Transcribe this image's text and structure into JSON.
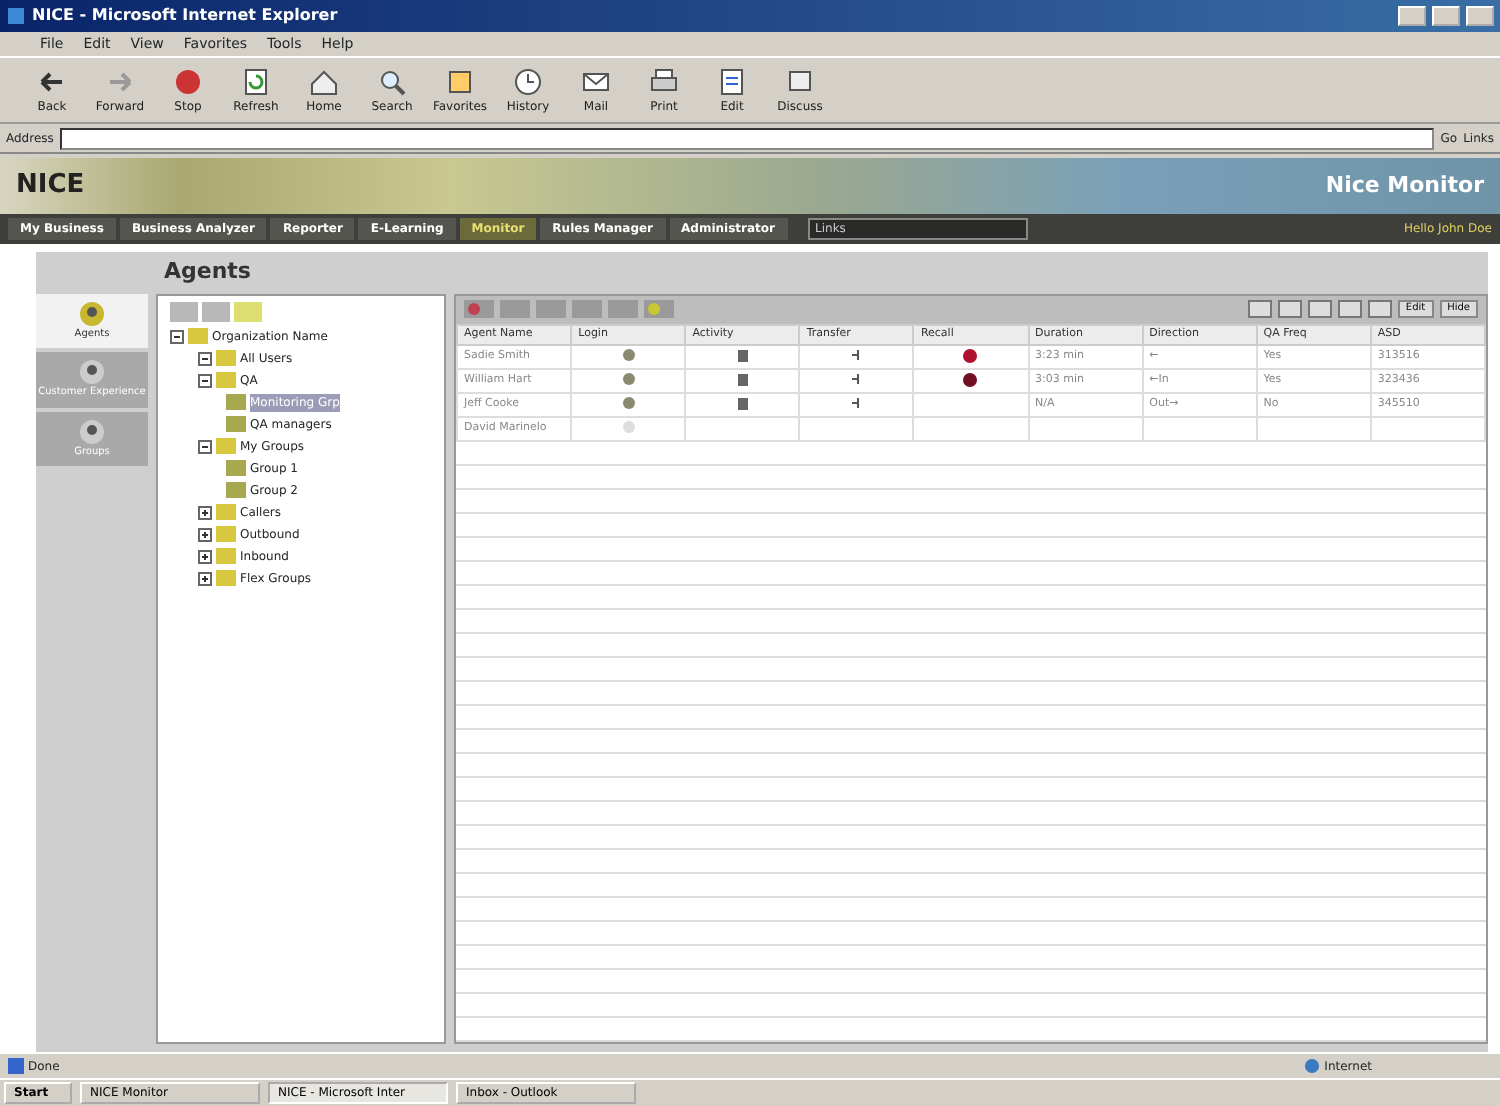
{
  "window": {
    "title": "NICE - Microsoft Internet Explorer"
  },
  "menu": [
    "File",
    "Edit",
    "View",
    "Favorites",
    "Tools",
    "Help"
  ],
  "toolbar": [
    {
      "label": "Back",
      "kind": "back"
    },
    {
      "label": "Forward",
      "kind": "forward"
    },
    {
      "label": "Stop",
      "kind": "stop"
    },
    {
      "label": "Refresh",
      "kind": "refresh"
    },
    {
      "label": "Home",
      "kind": "home"
    },
    {
      "label": "Search",
      "kind": "search"
    },
    {
      "label": "Favorites",
      "kind": "favorites"
    },
    {
      "label": "History",
      "kind": "history"
    },
    {
      "label": "Mail",
      "kind": "mail"
    },
    {
      "label": "Print",
      "kind": "print"
    },
    {
      "label": "Edit",
      "kind": "edit"
    },
    {
      "label": "Discuss",
      "kind": "discuss"
    }
  ],
  "address": {
    "label": "Address",
    "go": "Go",
    "links": "Links"
  },
  "banner": {
    "logo": "NICE",
    "product": "Nice Monitor"
  },
  "nav": {
    "tabs": [
      {
        "label": "My Business",
        "selected": false
      },
      {
        "label": "Business Analyzer",
        "selected": false
      },
      {
        "label": "Reporter",
        "selected": false
      },
      {
        "label": "E-Learning",
        "selected": false
      },
      {
        "label": "Monitor",
        "selected": true
      },
      {
        "label": "Rules Manager",
        "selected": false
      },
      {
        "label": "Administrator",
        "selected": false
      }
    ],
    "links": "Links",
    "greeting": "Hello John Doe"
  },
  "page_title": "Agents",
  "sidebar": [
    {
      "label": "Agents",
      "selected": true
    },
    {
      "label": "Customer Experience",
      "selected": false
    },
    {
      "label": "Groups",
      "selected": false
    }
  ],
  "tree": [
    {
      "label": "Organization Name",
      "expanded": true,
      "selected": false,
      "children": [
        {
          "label": "All Users",
          "expanded": true,
          "selected": false
        },
        {
          "label": "QA",
          "expanded": true,
          "selected": false,
          "children": [
            {
              "label": "Monitoring Grp",
              "selected": true
            },
            {
              "label": "QA managers",
              "selected": false
            }
          ]
        },
        {
          "label": "My Groups",
          "expanded": true,
          "selected": false,
          "children": [
            {
              "label": "Group 1",
              "selected": false
            },
            {
              "label": "Group 2",
              "selected": false
            }
          ]
        },
        {
          "label": "Callers",
          "expanded": false,
          "selected": false
        },
        {
          "label": "Outbound",
          "expanded": false,
          "selected": false
        },
        {
          "label": "Inbound",
          "expanded": false,
          "selected": false
        },
        {
          "label": "Flex Groups",
          "expanded": false,
          "selected": false
        }
      ]
    }
  ],
  "grid_toolbar": {
    "right_buttons": [
      "Edit",
      "Hide"
    ]
  },
  "table": {
    "columns": [
      "Agent Name",
      "Login",
      "Activity",
      "Transfer",
      "Recall",
      "Duration",
      "Direction",
      "QA Freq",
      "ASD"
    ],
    "rows": [
      {
        "agent": "Sadie Smith",
        "logged_in": true,
        "recall": {
          "color": "#b01030"
        },
        "duration": "3:23 min",
        "direction": "←",
        "qa_freq": "Yes",
        "asd": "313516"
      },
      {
        "agent": "William Hart",
        "logged_in": true,
        "recall": {
          "color": "#701020"
        },
        "duration": "3:03 min",
        "direction": "←In",
        "qa_freq": "Yes",
        "asd": "323436"
      },
      {
        "agent": "Jeff Cooke",
        "logged_in": true,
        "duration": "N/A",
        "direction": "Out→",
        "qa_freq": "No",
        "asd": "345510"
      },
      {
        "agent": "David Marinelo",
        "logged_in": false
      }
    ]
  },
  "status_bar": {
    "text": "Done",
    "zone": "Internet"
  },
  "taskbar": {
    "start": "Start",
    "tasks": [
      {
        "label": "NICE Monitor",
        "selected": false
      },
      {
        "label": "NICE - Microsoft Inter",
        "selected": true
      },
      {
        "label": "Inbox - Outlook",
        "selected": false
      }
    ]
  }
}
